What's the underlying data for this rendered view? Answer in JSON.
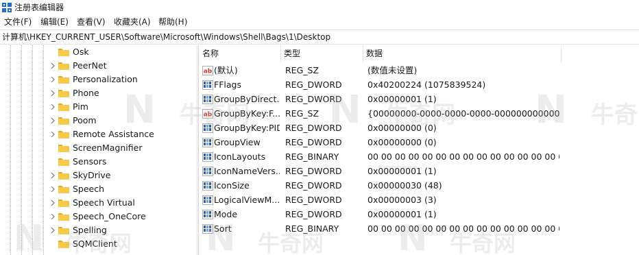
{
  "window": {
    "title": "注册表编辑器"
  },
  "menu": [
    "文件(F)",
    "编辑(E)",
    "查看(V)",
    "收藏夹(A)",
    "帮助(H)"
  ],
  "address": "计算机\\HKEY_CURRENT_USER\\Software\\Microsoft\\Windows\\Shell\\Bags\\1\\Desktop",
  "tree": {
    "items": [
      {
        "label": "Osk",
        "expandable": false
      },
      {
        "label": "PeerNet",
        "expandable": true
      },
      {
        "label": "Personalization",
        "expandable": true
      },
      {
        "label": "Phone",
        "expandable": true
      },
      {
        "label": "Pim",
        "expandable": true
      },
      {
        "label": "Poom",
        "expandable": true
      },
      {
        "label": "Remote Assistance",
        "expandable": true
      },
      {
        "label": "ScreenMagnifier",
        "expandable": false
      },
      {
        "label": "Sensors",
        "expandable": false
      },
      {
        "label": "SkyDrive",
        "expandable": true
      },
      {
        "label": "Speech",
        "expandable": true
      },
      {
        "label": "Speech Virtual",
        "expandable": true
      },
      {
        "label": "Speech_OneCore",
        "expandable": true
      },
      {
        "label": "Spelling",
        "expandable": true
      },
      {
        "label": "SQMClient",
        "expandable": false
      }
    ]
  },
  "list": {
    "columns": [
      "名称",
      "类型",
      "数据"
    ],
    "rows": [
      {
        "icon": "string-value-icon",
        "name": "(默认)",
        "type": "REG_SZ",
        "data": "(数值未设置)"
      },
      {
        "icon": "binary-value-icon",
        "name": "FFlags",
        "type": "REG_DWORD",
        "data": "0x40200224 (1075839524)"
      },
      {
        "icon": "binary-value-icon",
        "name": "GroupByDirect...",
        "type": "REG_DWORD",
        "data": "0x00000001 (1)"
      },
      {
        "icon": "string-value-icon",
        "name": "GroupByKey:F...",
        "type": "REG_SZ",
        "data": "{00000000-0000-0000-0000-000000000000}"
      },
      {
        "icon": "binary-value-icon",
        "name": "GroupByKey:PID",
        "type": "REG_DWORD",
        "data": "0x00000000 (0)"
      },
      {
        "icon": "binary-value-icon",
        "name": "GroupView",
        "type": "REG_DWORD",
        "data": "0x00000000 (0)"
      },
      {
        "icon": "binary-value-icon",
        "name": "IconLayouts",
        "type": "REG_BINARY",
        "data": "00 00 00 00 00 00 00 00 00 00 00 00 00 00 00 00..."
      },
      {
        "icon": "binary-value-icon",
        "name": "IconNameVers...",
        "type": "REG_DWORD",
        "data": "0x00000001 (1)"
      },
      {
        "icon": "binary-value-icon",
        "name": "IconSize",
        "type": "REG_DWORD",
        "data": "0x00000030 (48)"
      },
      {
        "icon": "binary-value-icon",
        "name": "LogicalViewM...",
        "type": "REG_DWORD",
        "data": "0x00000003 (3)"
      },
      {
        "icon": "binary-value-icon",
        "name": "Mode",
        "type": "REG_DWORD",
        "data": "0x00000001 (1)"
      },
      {
        "icon": "binary-value-icon",
        "name": "Sort",
        "type": "REG_BINARY",
        "data": "00 00 00 00 00 00 00 00 00 00 00 00 00 00 00 00..."
      }
    ]
  },
  "watermark": {
    "logo": "N",
    "text": "牛奇网"
  },
  "colors": {
    "folder": "#f7c948",
    "folder_dark": "#e0a92a",
    "string_icon": "#d33b2c",
    "binary_icon": "#2f5fb3",
    "app_icon": "#1f6fd1"
  }
}
